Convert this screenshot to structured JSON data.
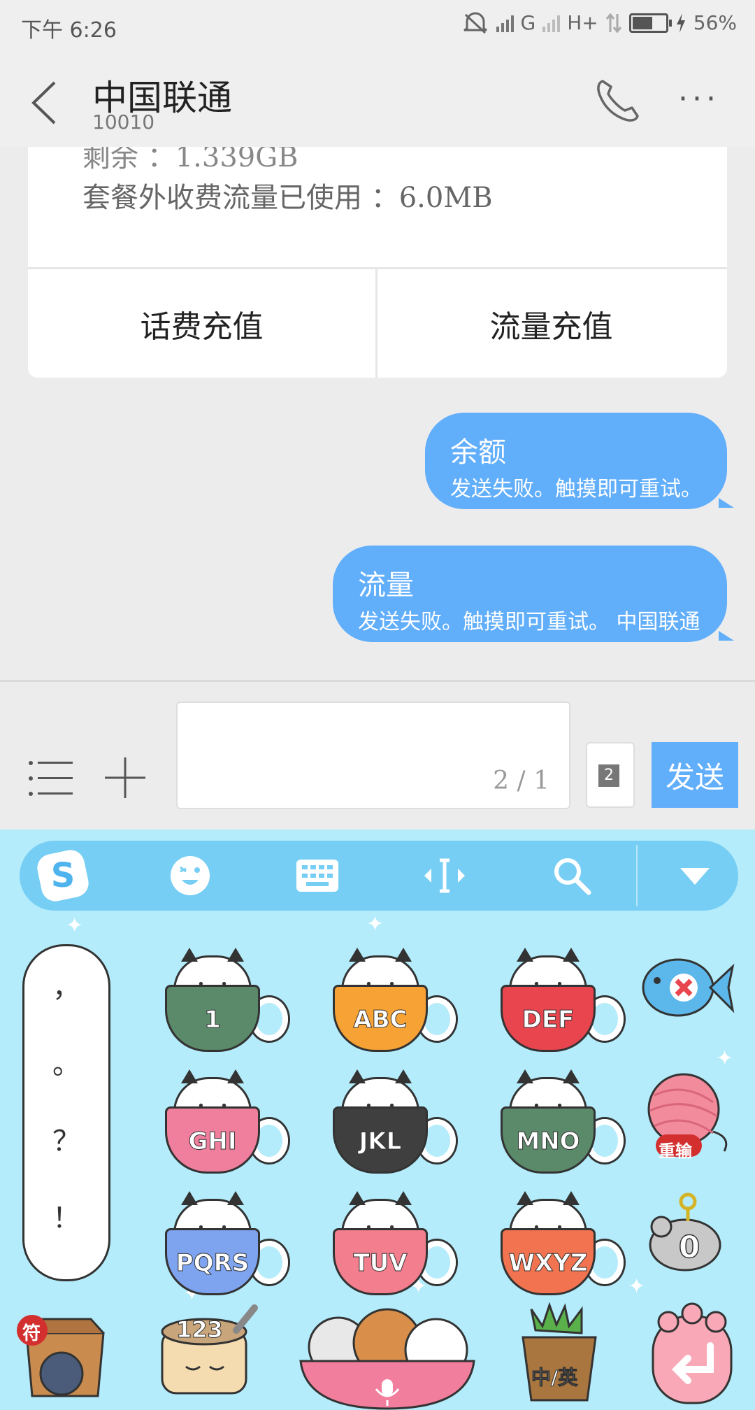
{
  "status_bar": {
    "time": "下午 6:26",
    "network_g": "G",
    "network_h": "H+",
    "battery": "56%",
    "battery_level": 0.56
  },
  "header": {
    "title": "中国联通",
    "number": "10010"
  },
  "card": {
    "line1": "剩余 ：1.339GB",
    "line2": "套餐外收费流量已使用 ：6.0MB",
    "buttons": [
      "话费充值",
      "流量充值"
    ]
  },
  "messages": [
    {
      "text": "余额",
      "status": "发送失败。触摸即可重试。"
    },
    {
      "text": "流量",
      "status": "发送失败。触摸即可重试。 中国联通"
    }
  ],
  "composer": {
    "counter": "2 / 1",
    "sim_label": "2",
    "send_label": "发送"
  },
  "keyboard": {
    "punctuation": [
      "，",
      "。",
      "？",
      "！"
    ],
    "keys": [
      {
        "label": "1",
        "color": "#5b8a6a"
      },
      {
        "label": "ABC",
        "color": "#f7a234"
      },
      {
        "label": "DEF",
        "color": "#e8454f"
      },
      {
        "label": "GHI",
        "color": "#f07e9d"
      },
      {
        "label": "JKL",
        "color": "#3f3f3f"
      },
      {
        "label": "MNO",
        "color": "#5b8a6a"
      },
      {
        "label": "PQRS",
        "color": "#7ea3ef"
      },
      {
        "label": "TUV",
        "color": "#f27e8e"
      },
      {
        "label": "WXYZ",
        "color": "#f27350"
      }
    ],
    "retype_label": "重输",
    "symbol_label": "符",
    "numbers_label": "123",
    "lang_label": "中/英"
  }
}
